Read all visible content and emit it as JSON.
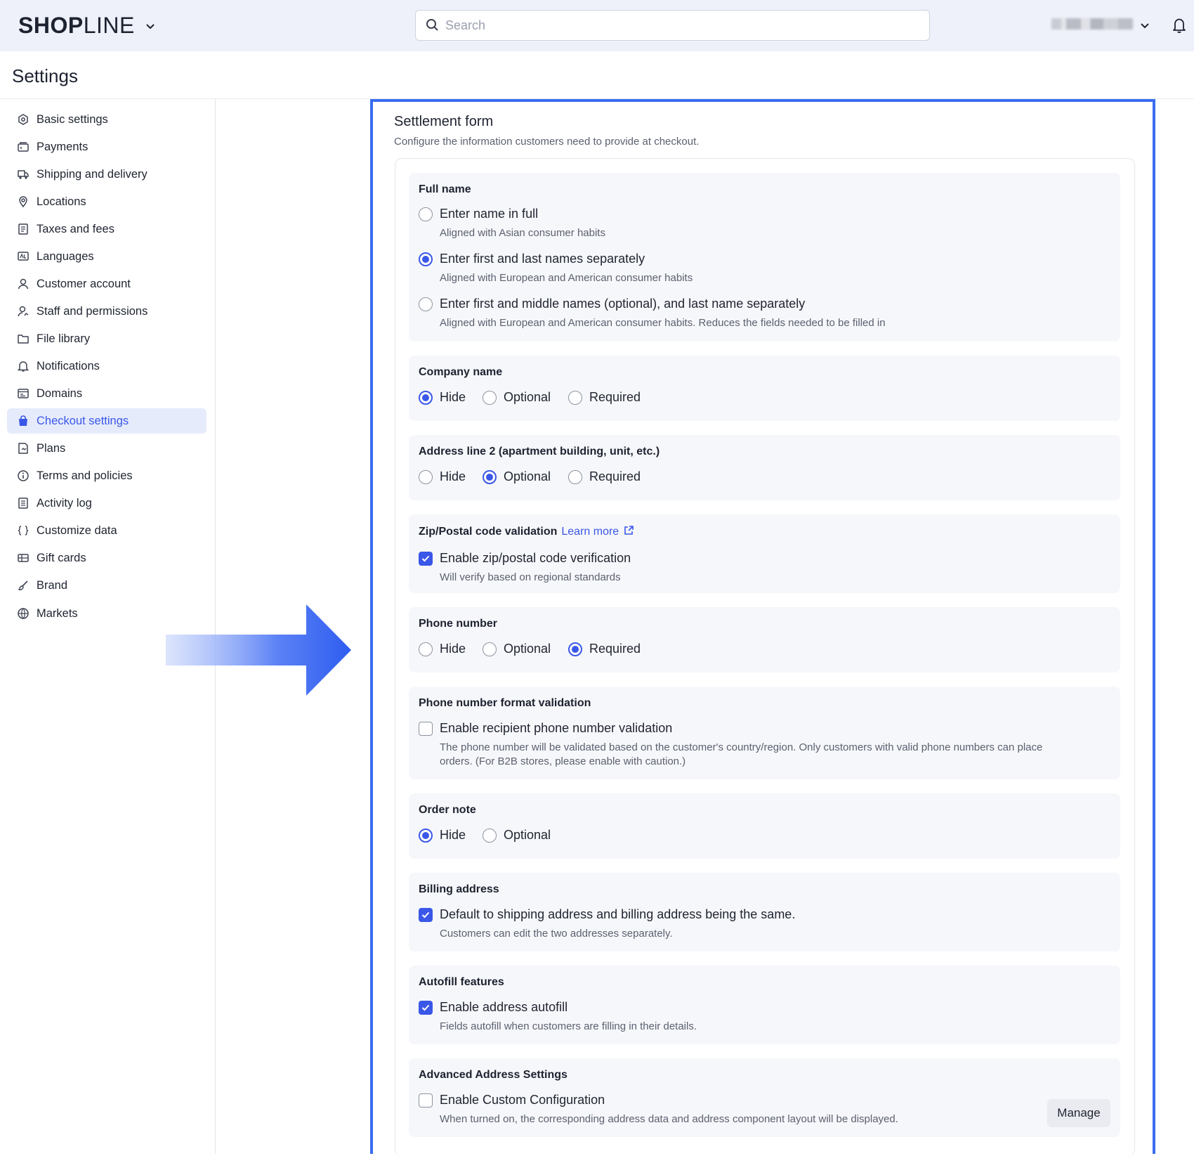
{
  "brand": {
    "logo_bold": "SHOP",
    "logo_thin": "LINE"
  },
  "search": {
    "placeholder": "Search"
  },
  "page": {
    "title": "Settings"
  },
  "sidebar": {
    "items": [
      {
        "label": "Basic settings",
        "icon": "basic-settings-icon"
      },
      {
        "label": "Payments",
        "icon": "payments-icon"
      },
      {
        "label": "Shipping and delivery",
        "icon": "truck-icon"
      },
      {
        "label": "Locations",
        "icon": "location-pin-icon"
      },
      {
        "label": "Taxes and fees",
        "icon": "receipt-icon"
      },
      {
        "label": "Languages",
        "icon": "language-icon"
      },
      {
        "label": "Customer account",
        "icon": "user-icon"
      },
      {
        "label": "Staff and permissions",
        "icon": "staff-icon"
      },
      {
        "label": "File library",
        "icon": "folder-icon"
      },
      {
        "label": "Notifications",
        "icon": "bell-icon"
      },
      {
        "label": "Domains",
        "icon": "domain-icon"
      },
      {
        "label": "Checkout settings",
        "icon": "shopping-bag-icon",
        "active": true
      },
      {
        "label": "Plans",
        "icon": "plans-icon"
      },
      {
        "label": "Terms and policies",
        "icon": "info-icon"
      },
      {
        "label": "Activity log",
        "icon": "log-icon"
      },
      {
        "label": "Customize data",
        "icon": "code-braces-icon"
      },
      {
        "label": "Gift cards",
        "icon": "gift-card-icon"
      },
      {
        "label": "Brand",
        "icon": "brush-icon"
      },
      {
        "label": "Markets",
        "icon": "globe-icon"
      }
    ]
  },
  "form": {
    "title": "Settlement form",
    "subtitle": "Configure the information customers need to provide at checkout.",
    "full_name": {
      "title": "Full name",
      "options": [
        {
          "label": "Enter name in full",
          "desc": "Aligned with Asian consumer habits",
          "selected": false
        },
        {
          "label": "Enter first and last names separately",
          "desc": "Aligned with European and American consumer habits",
          "selected": true
        },
        {
          "label": "Enter first and middle names (optional), and last name separately",
          "desc": "Aligned with European and American consumer habits. Reduces the fields needed to be filled in",
          "selected": false
        }
      ]
    },
    "company_name": {
      "title": "Company name",
      "options": [
        "Hide",
        "Optional",
        "Required"
      ],
      "selected": "Hide"
    },
    "address_line2": {
      "title": "Address line 2 (apartment building, unit, etc.)",
      "options": [
        "Hide",
        "Optional",
        "Required"
      ],
      "selected": "Optional"
    },
    "zip": {
      "title": "Zip/Postal code validation",
      "learn_more": "Learn more",
      "checkbox_label": "Enable zip/postal code verification",
      "checked": true,
      "desc": "Will verify based on regional standards"
    },
    "phone": {
      "title": "Phone number",
      "options": [
        "Hide",
        "Optional",
        "Required"
      ],
      "selected": "Required"
    },
    "phone_format": {
      "title": "Phone number format validation",
      "checkbox_label": "Enable recipient phone number validation",
      "checked": false,
      "desc_line1": "The phone number will be validated based on the customer's country/region. Only customers with valid phone numbers can place",
      "desc_line2": "orders. (For B2B stores, please enable with caution.)"
    },
    "order_note": {
      "title": "Order note",
      "options": [
        "Hide",
        "Optional"
      ],
      "selected": "Hide"
    },
    "billing": {
      "title": "Billing address",
      "checkbox_label": "Default to shipping address and billing address being the same.",
      "checked": true,
      "desc": "Customers can edit the two addresses separately."
    },
    "autofill": {
      "title": "Autofill features",
      "checkbox_label": "Enable address autofill",
      "checked": true,
      "desc": "Fields autofill when customers are filling in their details."
    },
    "advanced": {
      "title": "Advanced Address Settings",
      "checkbox_label": "Enable Custom Configuration",
      "checked": false,
      "desc": "When turned on, the corresponding address data and address component layout will be displayed.",
      "button": "Manage"
    }
  },
  "colors": {
    "accent": "#3a57e8",
    "highlight_border": "#3a6cf0",
    "topbar_bg": "#eef0fa"
  }
}
